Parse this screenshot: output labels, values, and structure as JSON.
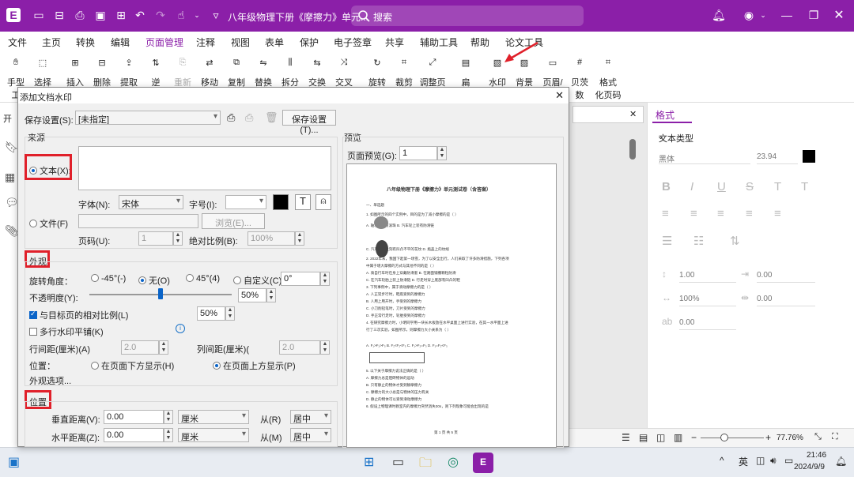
{
  "titlebar": {
    "doc_title": "八年级物理下册《摩擦力》单元...",
    "search_placeholder": "搜索",
    "colors": {
      "brand": "#8b1fa8"
    }
  },
  "menu": {
    "items": [
      "文件",
      "主页",
      "转换",
      "编辑",
      "页面管理",
      "注释",
      "视图",
      "表单",
      "保护",
      "电子签章",
      "共享",
      "辅助工具",
      "帮助",
      "论文工具"
    ],
    "active": "页面管理"
  },
  "ribbon": {
    "buttons": [
      {
        "label": "手型",
        "label2": "工",
        "icon": "hand-icon"
      },
      {
        "label": "选择",
        "label2": "",
        "icon": "select-icon"
      },
      {
        "label": "插入",
        "label2": "",
        "icon": "insert-page-icon"
      },
      {
        "label": "删除",
        "label2": "",
        "icon": "delete-page-icon"
      },
      {
        "label": "提取",
        "label2": "",
        "icon": "extract-page-icon"
      },
      {
        "label": "逆",
        "label2": "",
        "icon": "reverse-icon"
      },
      {
        "label": "重新",
        "label2": "",
        "icon": "renumber-icon"
      },
      {
        "label": "移动",
        "label2": "",
        "icon": "move-page-icon"
      },
      {
        "label": "复制",
        "label2": "",
        "icon": "copy-page-icon"
      },
      {
        "label": "替换",
        "label2": "",
        "icon": "replace-page-icon"
      },
      {
        "label": "拆分",
        "label2": "",
        "icon": "split-icon"
      },
      {
        "label": "交换",
        "label2": "",
        "icon": "swap-icon"
      },
      {
        "label": "交叉",
        "label2": "",
        "icon": "cross-icon"
      },
      {
        "label": "旋转",
        "label2": "",
        "icon": "rotate-icon"
      },
      {
        "label": "裁剪",
        "label2": "",
        "icon": "crop-icon"
      },
      {
        "label": "调整页",
        "label2": "",
        "icon": "resize-icon"
      },
      {
        "label": "扁",
        "label2": "",
        "icon": "flatten-icon"
      },
      {
        "label": "水印",
        "label2": "",
        "icon": "watermark-icon"
      },
      {
        "label": "背景",
        "label2": "",
        "icon": "background-icon"
      },
      {
        "label": "页眉/",
        "label2": "",
        "icon": "header-icon"
      },
      {
        "label": "贝茨",
        "label2": "数",
        "icon": "bates-icon"
      },
      {
        "label": "格式",
        "label2": "化页码",
        "icon": "page-number-icon"
      }
    ]
  },
  "left_tab_label": "开",
  "dialog": {
    "title": "添加文档水印",
    "save_settings_label": "保存设置(S):",
    "save_settings_value": "[未指定]",
    "save_settings_button": "保存设置(T)...",
    "source_title": "来源",
    "text_radio": "文本(X):",
    "font_label": "字体(N):",
    "font_value": "宋体",
    "size_label": "字号(I):",
    "file_radio": "文件(F)",
    "browse_button": "浏览(E)...",
    "page_label": "页码(U):",
    "page_value": "1",
    "abs_scale_label": "绝对比例(B):",
    "abs_scale_value": "100%",
    "appearance_title": "外观",
    "rotation_label": "旋转角度：",
    "rot_opts": [
      "-45°(-)",
      "无(O)",
      "45°(4)",
      "自定义(C)"
    ],
    "rot_custom_value": "0°",
    "opacity_label": "不透明度(Y):",
    "opacity_value": "50%",
    "opacity_level": 0.5,
    "relative_check": "与目标页的相对比例(L)",
    "relative_value": "50%",
    "tile_check": "多行水印平铺(K)",
    "info_icon": "info-icon",
    "row_spacing_label": "行间距(厘米)(A)",
    "row_spacing_value": "2.0",
    "col_spacing_label": "列间距(厘米)(",
    "col_spacing_value": "2.0",
    "position_label": "位置：",
    "pos_behind": "在页面下方显示(H)",
    "pos_front": "在页面上方显示(P)",
    "appearance_options": "外观选项...",
    "position_title": "位置",
    "vdist_label": "垂直距离(V):",
    "vdist_value": "0.00",
    "vdist_unit": "厘米",
    "from_r_label": "从(R)",
    "from_r_value": "居中",
    "hdist_label": "水平距离(Z):",
    "hdist_value": "0.00",
    "hdist_unit": "厘米",
    "from_m_label": "从(M)",
    "from_m_value": "居中",
    "preview_title": "预览",
    "preview_page_label": "页面预览(G):",
    "preview_page_value": "1",
    "preview_doc": {
      "title": "八年级物理下册《摩擦力》单元测试卷（含答案）",
      "lines": [
        "一、单选题",
        "1. 如图所示的四个实例中，目的是为了减小摩擦的是（     ）",
        "A.       轴承中装有滚珠          B.            汽车轮上装有防滑链",
        "C.       汽车轮胎上刻有凹凸不平的花纹    D.            瓶盖上的纹线",
        "2. 2022年末，我国下起第一场雪，为了以安全出行，人们采取了许多防滑措施，下列各项",
        "中属于增大摩擦的方式与其他不同的是（     ）",
        "A. 骑自行车时在身上穿戴防滑套      B. 在路面铺撒颗粒防滑",
        "C. 在汽车轮胎上装上防滑链          D. 行走时穿上底部有凹凸的鞋",
        "3. 下列事例中，属于滑动摩擦力的是（     ）",
        "A. 人正常步行时，鞋底受到的摩擦力",
        "B. 人用上用开时，手受到的摩擦力",
        "C. 小刀削铅笔时，刀片受到的摩擦力",
        "D. 手正常行走时，轮胎受到的摩擦力",
        "4. 在研究摩擦力时，小明同学用一块长木板放在水平桌面上进行实验，在其一水平面上进",
        "行了三次实验，如图所示，则摩擦力大小关系为（     ）",
        "A. F₁>F₂>F₃      B. F₁<F₂<F₃      C. F₁>F₂=F₃      D. F₁=F₂<F₃",
        "5. 以下关于摩擦力说法正确的是（     ）",
        "A. 摩擦力总是阻碍物体的运动",
        "B. 只有静止的物体才受到静摩擦力",
        "C. 摩擦力的大小总是与物体的压力有关",
        "D. 静止的物体可以受到滑动摩擦力",
        "6. 假设上物理课时教室内的摩擦力突然消失30s，则下列现象可能会出现的是",
        "第 1 页 共 5 页"
      ]
    }
  },
  "right_panel": {
    "tab": "格式",
    "section": "文本类型",
    "font": "黑体",
    "size": "23.94",
    "line_spacing": "1.00",
    "indent": "0.00",
    "scale": "100%",
    "spacing": "0.00",
    "char_spacing": "0.00"
  },
  "statusbar": {
    "zoom": "77.76%",
    "zoom_level": 0.38
  },
  "taskbar": {
    "lang": "英",
    "time": "21:46",
    "date": "2024/9/9"
  }
}
